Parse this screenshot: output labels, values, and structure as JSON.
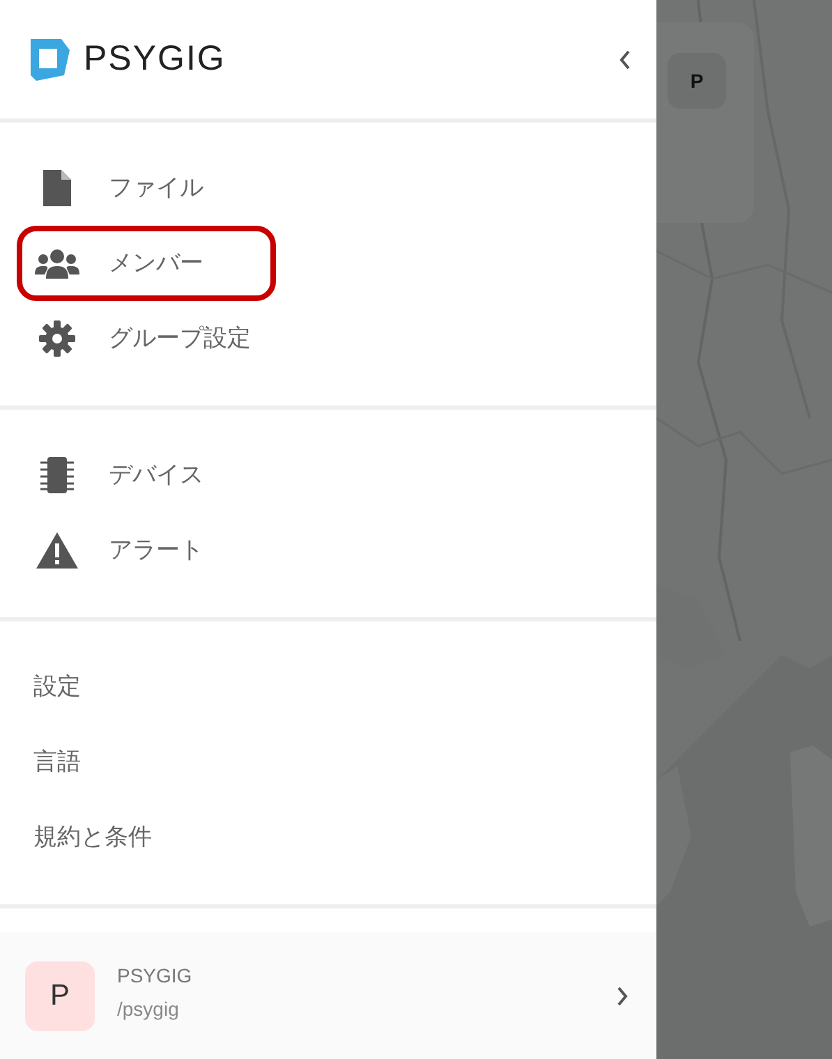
{
  "logo": {
    "text": "PSYGIG"
  },
  "sections": [
    {
      "items": [
        {
          "kind": "file",
          "label": "ファイル",
          "highlighted": false
        },
        {
          "kind": "members",
          "label": "メンバー",
          "highlighted": true
        },
        {
          "kind": "gear",
          "label": "グループ設定",
          "highlighted": false
        }
      ]
    },
    {
      "items": [
        {
          "kind": "chip",
          "label": "デバイス",
          "highlighted": false
        },
        {
          "kind": "alert",
          "label": "アラート",
          "highlighted": false
        }
      ]
    },
    {
      "items": [
        {
          "kind": "plain",
          "label": "設定",
          "highlighted": false
        },
        {
          "kind": "plain",
          "label": "言語",
          "highlighted": false
        },
        {
          "kind": "plain",
          "label": "規約と条件",
          "highlighted": false
        }
      ]
    }
  ],
  "account": {
    "avatar": "P",
    "name": "PSYGIG",
    "path": "/psygig"
  },
  "map_card": {
    "avatar": "P"
  }
}
